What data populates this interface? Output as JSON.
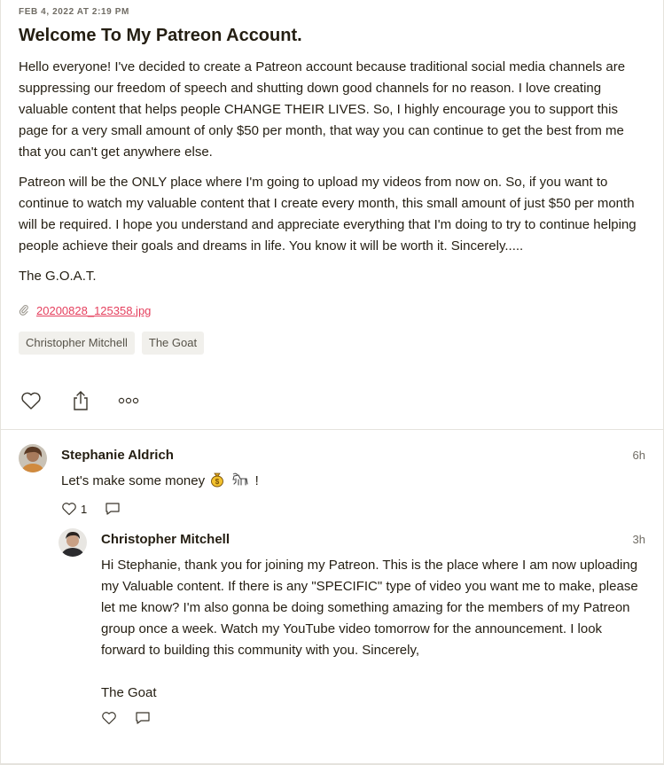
{
  "post": {
    "date": "FEB 4, 2022 AT 2:19 PM",
    "title": "Welcome To My Patreon Account.",
    "paragraph1": "Hello everyone! I've decided to create a Patreon account because traditional social media channels are suppressing our freedom of speech and shutting down good channels for no reason. I love creating valuable content that helps people CHANGE THEIR LIVES. So, I highly encourage you to support this page for a very small amount of only $50 per month, that way you can continue to get the best from me that you can't get anywhere else.",
    "paragraph2": "Patreon will be the ONLY place where I'm going to upload my videos from now on. So, if you want to continue to watch my valuable content that I create every month, this small amount of just $50 per month will be required. I hope you understand and appreciate everything that I'm doing to try to continue helping people achieve their goals and dreams in life. You know it will be worth it. Sincerely.....",
    "signoff": "The G.O.A.T.",
    "attachment": "20200828_125358.jpg",
    "tags": [
      "Christopher Mitchell",
      "The Goat"
    ],
    "actions": {
      "like_icon": "heart-outline-icon",
      "share_icon": "share-icon",
      "more_icon": "more-dots-icon"
    }
  },
  "comments": [
    {
      "author": "Stephanie Aldrich",
      "time": "6h",
      "text_before": "Let's make some money",
      "emojis": [
        "money-bag-icon",
        "goat-icon"
      ],
      "text_after": "!",
      "like_count": "1",
      "reply": {
        "author": "Christopher Mitchell",
        "time": "3h",
        "text": "Hi Stephanie, thank you for joining my Patreon. This is the place where I am now uploading my Valuable content. If there is any \"SPECIFIC\" type of video you want me to make, please let me know? I'm also gonna be doing something amazing for the members of my Patreon group once a week. Watch my YouTube video tomorrow for the announcement. I look forward to building this community with you. Sincerely,",
        "signoff": "The Goat"
      }
    }
  ],
  "colors": {
    "text": "#241e12",
    "muted": "#706c64",
    "link": "#e5405e",
    "tag_bg": "#f1f0ec",
    "divider": "#e5e3dd"
  }
}
